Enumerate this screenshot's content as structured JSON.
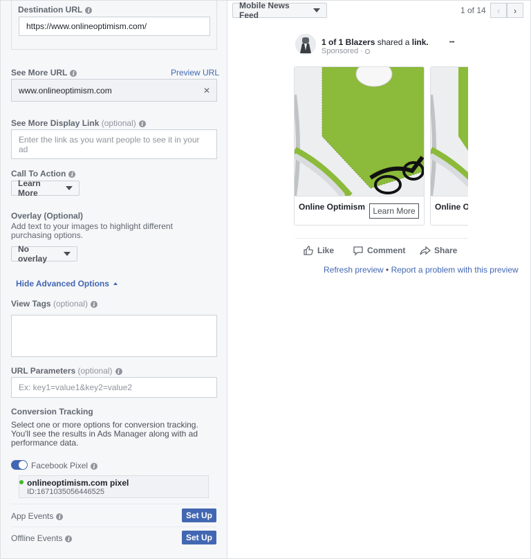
{
  "form": {
    "destination_url": {
      "label": "Destination URL",
      "value": "https://www.onlineoptimism.com/"
    },
    "see_more_url": {
      "label": "See More URL",
      "preview_link": "Preview URL",
      "value": "www.onlineoptimism.com",
      "clear_glyph": "✕"
    },
    "see_more_display": {
      "label": "See More Display Link",
      "optional": "(optional)",
      "placeholder_line1": "Enter the link as you want people to see it in your",
      "placeholder_line2": "ad"
    },
    "call_to_action": {
      "label": "Call To Action",
      "selected": "Learn More"
    },
    "overlay": {
      "label": "Overlay (Optional)",
      "desc_line1": "Add text to your images to highlight different",
      "desc_line2": "purchasing options.",
      "selected": "No overlay"
    },
    "hide_advanced": "Hide Advanced Options",
    "view_tags": {
      "label": "View Tags",
      "optional": "(optional)"
    },
    "url_parameters": {
      "label": "URL Parameters",
      "optional": "(optional)",
      "placeholder": "Ex: key1=value1&key2=value2"
    },
    "conversion": {
      "label": "Conversion Tracking",
      "desc_line1": "Select one or more options for conversion tracking.",
      "desc_line2": "You'll see the results in Ads Manager along with ad",
      "desc_line3": "performance data.",
      "facebook_pixel": {
        "label": "Facebook Pixel",
        "enabled": true
      },
      "pixel": {
        "name": "onlineoptimism.com pixel",
        "id": "ID:1671035056446525",
        "status_color": "#42b72a"
      },
      "app_events": {
        "label": "App Events",
        "button": "Set Up"
      },
      "offline_events": {
        "label": "Offline Events",
        "button": "Set Up"
      }
    }
  },
  "preview": {
    "placement": "Mobile News Feed",
    "pager": "1 of 14",
    "prev_glyph": "‹",
    "next_glyph": "›",
    "post": {
      "line_bold": "1 of 1 Blazers",
      "line_mid": " shared a ",
      "line_link": "link.",
      "sponsored": "Sponsored · ",
      "more": "•••"
    },
    "cards": [
      {
        "title": "Online Optimism",
        "button": "Learn More"
      },
      {
        "title": "Online O"
      }
    ],
    "actions": {
      "like": "Like",
      "comment": "Comment",
      "share": "Share"
    },
    "footer": {
      "refresh": "Refresh preview",
      "bullet": " • ",
      "report": "Report a problem with this preview"
    }
  },
  "colors": {
    "accent": "#4267b2",
    "toggle": "#4267b2",
    "green_mat": "#8cba3a"
  }
}
